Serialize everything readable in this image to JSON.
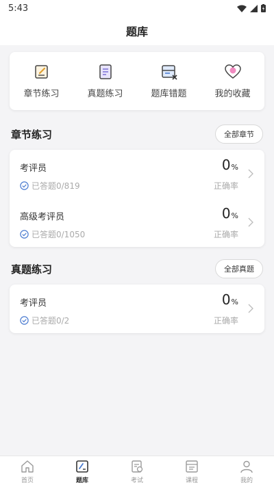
{
  "status": {
    "time": "5:43"
  },
  "header": {
    "title": "题库"
  },
  "quick_actions": [
    {
      "label": "章节练习",
      "icon": "edit-note-icon"
    },
    {
      "label": "真题练习",
      "icon": "document-icon"
    },
    {
      "label": "题库错题",
      "icon": "wrong-questions-icon"
    },
    {
      "label": "我的收藏",
      "icon": "heart-icon"
    }
  ],
  "chapter_section": {
    "title": "章节练习",
    "button": "全部章节",
    "items": [
      {
        "name": "考评员",
        "progress": "已答题0/819",
        "rate": "0",
        "rate_unit": "%",
        "rate_label": "正确率"
      },
      {
        "name": "高级考评员",
        "progress": "已答题0/1050",
        "rate": "0",
        "rate_unit": "%",
        "rate_label": "正确率"
      }
    ]
  },
  "exam_section": {
    "title": "真题练习",
    "button": "全部真题",
    "items": [
      {
        "name": "考评员",
        "progress": "已答题0/2",
        "rate": "0",
        "rate_unit": "%",
        "rate_label": "正确率"
      }
    ]
  },
  "tabbar": [
    {
      "label": "首页",
      "icon": "home-icon"
    },
    {
      "label": "题库",
      "icon": "question-bank-icon",
      "active": true
    },
    {
      "label": "考试",
      "icon": "exam-icon"
    },
    {
      "label": "课程",
      "icon": "course-icon"
    },
    {
      "label": "我的",
      "icon": "profile-icon"
    }
  ],
  "colors": {
    "accent": "#4a7bd0",
    "heart": "#e84c8a",
    "background": "#f4f4f6"
  }
}
